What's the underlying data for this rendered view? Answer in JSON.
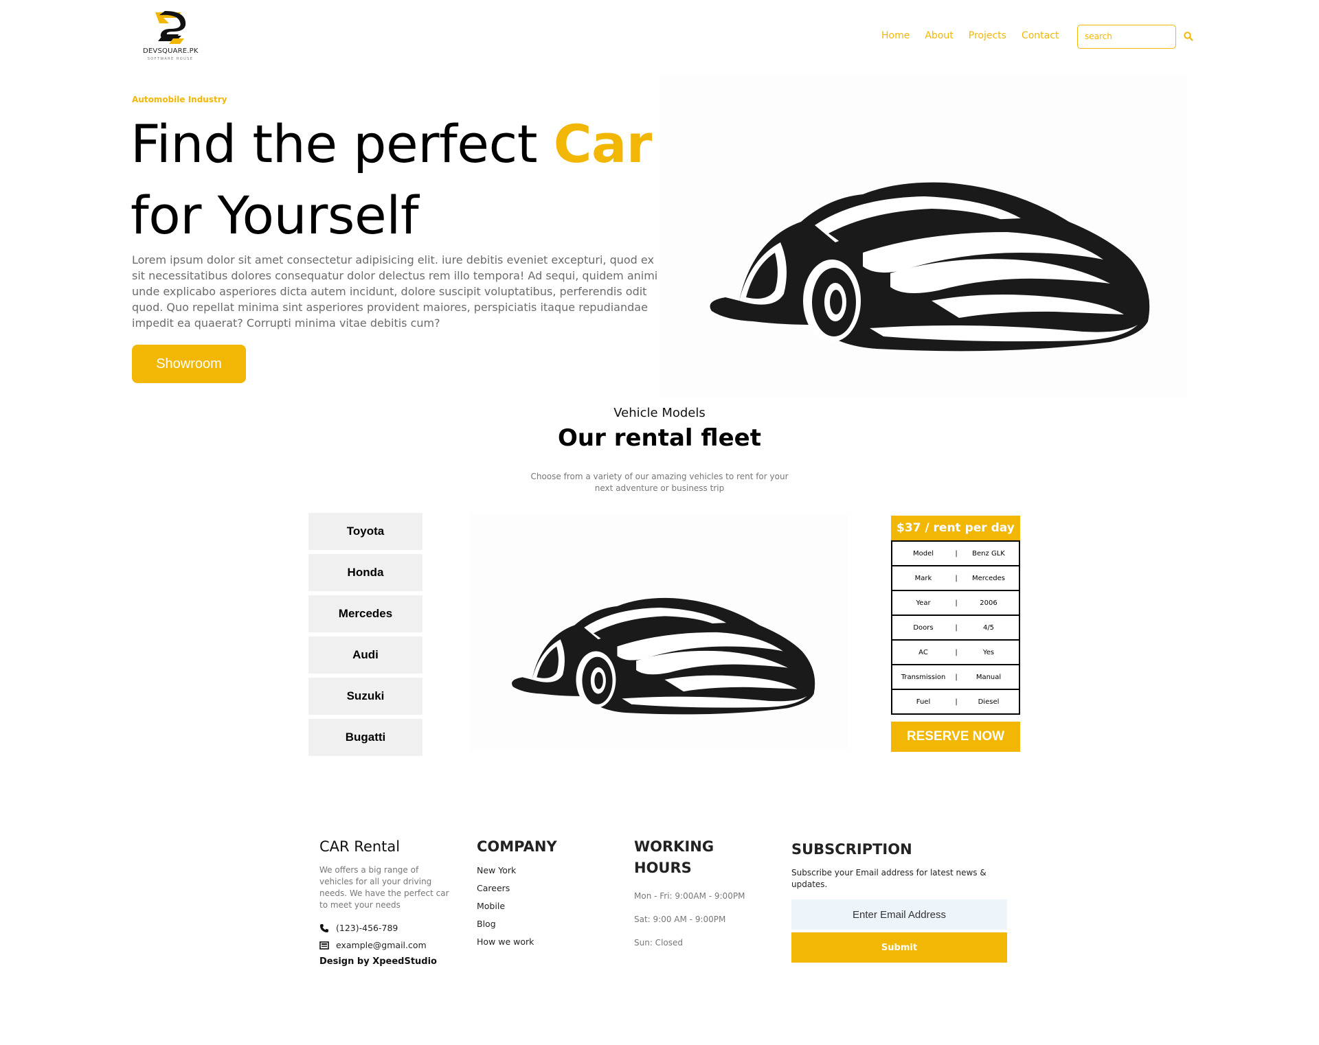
{
  "brand": {
    "name": "DEVSQUARE.PK",
    "tagline": "SOFTWARE HOUSE"
  },
  "nav": {
    "items": [
      "Home",
      "About",
      "Projects",
      "Contact"
    ],
    "search_placeholder": "search"
  },
  "hero": {
    "eyebrow": "Automobile Industry",
    "title_part1": "Find the perfect ",
    "title_accent": "Car",
    "title_part2": "for Yourself",
    "body": "Lorem ipsum dolor sit amet consectetur adipisicing elit. iure debitis eveniet excepturi, quod ex sit necessitatibus dolores consequatur dolor delectus rem illo tempora! Ad sequi, quidem animi unde explicabo asperiores dicta autem incidunt, dolore suscipit voluptatibus, perferendis odit quod. Quo repellat minima sint asperiores provident maiores, perspiciatis itaque repudiandae impedit ea quaerat? Corrupti minima vitae debitis cum?",
    "cta": "Showroom"
  },
  "fleet": {
    "eyebrow": "Vehicle Models",
    "title": "Our rental fleet",
    "subtitle": "Choose from a variety of our amazing vehicles to rent for your next adventure or business trip",
    "brands": [
      "Toyota",
      "Honda",
      "Mercedes",
      "Audi",
      "Suzuki",
      "Bugatti"
    ],
    "price": "$37 / rent per day",
    "specs": [
      {
        "key": "Model",
        "value": "Benz GLK"
      },
      {
        "key": "Mark",
        "value": "Mercedes"
      },
      {
        "key": "Year",
        "value": "2006"
      },
      {
        "key": "Doors",
        "value": "4/5"
      },
      {
        "key": "AC",
        "value": "Yes"
      },
      {
        "key": "Transmission",
        "value": "Manual"
      },
      {
        "key": "Fuel",
        "value": "Diesel"
      }
    ],
    "separator": "|",
    "reserve": "RESERVE NOW"
  },
  "footer": {
    "about": {
      "title": "CAR Rental",
      "text": "We offers a big range of vehicles for all your driving needs. We have the perfect car to meet your needs",
      "phone": "(123)-456-789",
      "email": "example@gmail.com",
      "credit": "Design by XpeedStudio"
    },
    "company": {
      "title": "COMPANY",
      "links": [
        "New York",
        "Careers",
        "Mobile",
        "Blog",
        "How we work"
      ]
    },
    "hours": {
      "title": "WORKING HOURS",
      "lines": [
        "Mon - Fri: 9:00AM - 9:00PM",
        "Sat: 9:00 AM - 9:00PM",
        "Sun: Closed"
      ]
    },
    "subscription": {
      "title": "SUBSCRIPTION",
      "text": "Subscribe your Email address for latest news & updates.",
      "placeholder": "Enter Email Address",
      "submit": "Submit"
    }
  },
  "colors": {
    "accent": "#f2b705",
    "text": "#111111",
    "muted": "#777777"
  }
}
